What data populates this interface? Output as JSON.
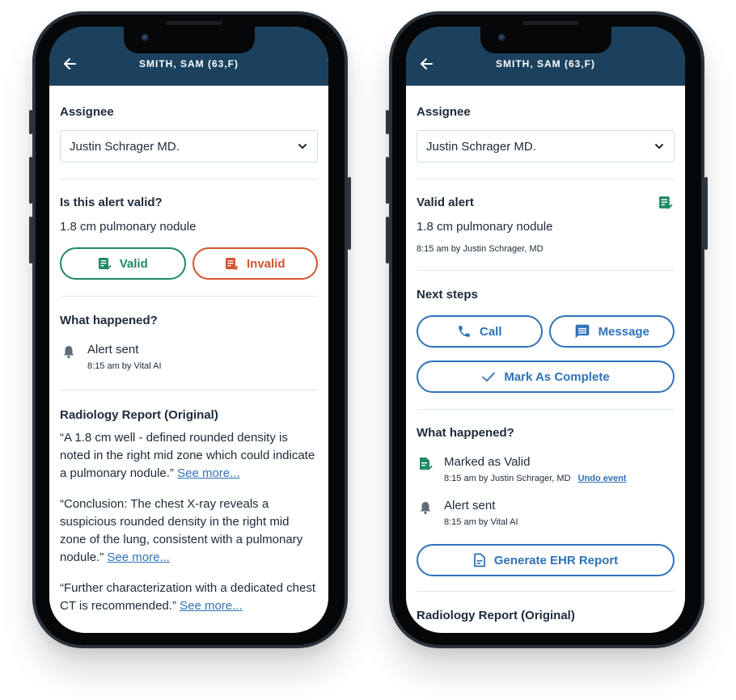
{
  "colors": {
    "header_bg": "#1b415e",
    "primary_blue": "#2f72b8",
    "valid_green": "#1e8a63",
    "invalid_red": "#d2532e",
    "text_dark": "#1d2b3a",
    "bell_gray": "#5f6b77"
  },
  "left_screen": {
    "header": {
      "back_icon": "arrow-left-icon",
      "title": "SMITH, SAM (63,F)"
    },
    "assignee": {
      "label": "Assignee",
      "value": "Justin Schrager MD.",
      "dropdown_icon": "chevron-down-icon"
    },
    "validation": {
      "question": "Is this alert valid?",
      "finding": "1.8 cm pulmonary nodule",
      "valid_button": {
        "label": "Valid",
        "icon": "document-check-icon"
      },
      "invalid_button": {
        "label": "Invalid",
        "icon": "document-x-icon"
      }
    },
    "what_happened": {
      "title": "What happened?",
      "events": [
        {
          "icon": "bell-icon",
          "title": "Alert sent",
          "meta": "8:15 am by Vital AI"
        }
      ]
    },
    "radiology": {
      "title": "Radiology Report (Original)",
      "paragraphs": [
        {
          "text": "“A 1.8 cm well - defined rounded density is noted in the right mid zone which could indicate a pulmonary nodule.”",
          "link": "See more..."
        },
        {
          "text": "“Conclusion: The chest X-ray reveals a suspicious rounded density in the right mid zone of the lung, consistent with a pulmonary nodule.”",
          "link": "See more..."
        },
        {
          "text": "“Further characterization with a dedicated chest CT is recommended.”",
          "link": "See more..."
        }
      ]
    }
  },
  "right_screen": {
    "header": {
      "back_icon": "arrow-left-icon",
      "title": "SMITH, SAM (63,F)"
    },
    "assignee": {
      "label": "Assignee",
      "value": "Justin Schrager MD.",
      "dropdown_icon": "chevron-down-icon"
    },
    "valid_alert": {
      "title": "Valid alert",
      "icon": "document-check-icon",
      "finding": "1.8 cm pulmonary nodule",
      "meta": "8:15 am by Justin Schrager, MD"
    },
    "next_steps": {
      "title": "Next steps",
      "call_label": "Call",
      "message_label": "Message",
      "complete_label": "Mark As Complete"
    },
    "what_happened": {
      "title": "What happened?",
      "events": [
        {
          "icon": "document-check-icon",
          "title": "Marked as Valid",
          "meta": "8:15 am by Justin Schrager, MD",
          "action": "Undo event"
        },
        {
          "icon": "bell-icon",
          "title": "Alert sent",
          "meta": "8:15 am by Vital AI"
        }
      ],
      "ehr_button_label": "Generate EHR Report"
    },
    "radiology": {
      "title": "Radiology Report (Original)"
    }
  }
}
